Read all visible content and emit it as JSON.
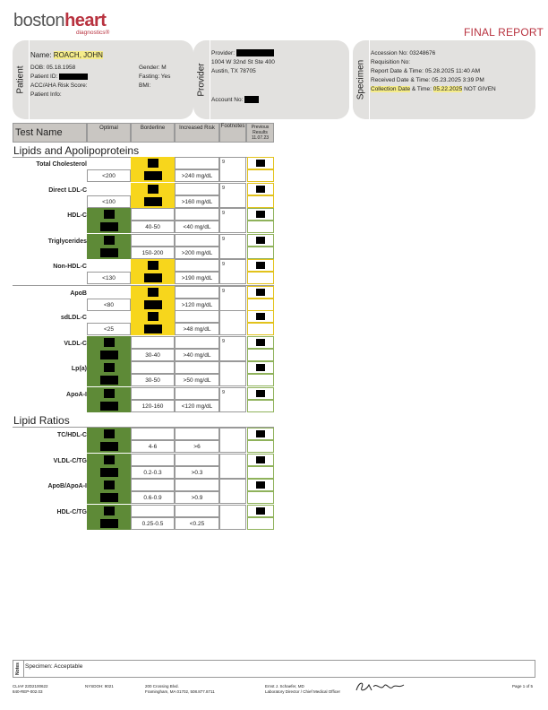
{
  "header": {
    "logo_main_a": "boston",
    "logo_main_b": "heart",
    "logo_sub": "diagnostics®",
    "report_title": "FINAL REPORT"
  },
  "patient": {
    "section_label": "Patient",
    "name_label": "Name:",
    "name_value": "ROACH, JOHN",
    "dob": "DOB: 05.18.1958",
    "patient_id_label": "Patient ID:",
    "risk_label": "ACC/AHA Risk Score:",
    "info_label": "Patient Info:",
    "gender": "Gender: M",
    "fasting": "Fasting: Yes",
    "bmi": "BMI:"
  },
  "provider": {
    "section_label": "Provider",
    "provider_label": "Provider:",
    "address1": "1004 W 32nd St Ste 400",
    "address2": "Austin, TX 78705",
    "account_label": "Account No:"
  },
  "specimen": {
    "section_label": "Specimen",
    "accession": "Accession No: 03248676",
    "requisition": "Requisition No:",
    "report_date": "Report Date & Time: 05.28.2025 11:40 AM",
    "received_date": "Received Date & Time: 05.23.2025 3:39 PM",
    "collection_label": "Collection Date",
    "collection_mid": " & Time: ",
    "collection_date": "05.22.2025",
    "collection_note": " NOT GIVEN"
  },
  "table_header": {
    "test_name": "Test Name",
    "optimal": "Optimal",
    "borderline": "Borderline",
    "increased": "Increased Risk",
    "footnotes": "Footnotes",
    "previous": "Previous Results",
    "previous_date": "11.07.23"
  },
  "sections": {
    "lipids": "Lipids and Apolipoproteins",
    "ratios": "Lipid Ratios"
  },
  "tests": [
    {
      "name": "Total Cholesterol",
      "optimal": "<200",
      "borderline": "",
      "increased": ">240 mg/dL",
      "footnote": "9",
      "zone": "borderline"
    },
    {
      "name": "Direct LDL-C",
      "optimal": "<100",
      "borderline": "",
      "increased": ">160 mg/dL",
      "footnote": "9",
      "zone": "borderline"
    },
    {
      "name": "HDL-C",
      "optimal": "",
      "borderline": "40-50",
      "increased": "<40 mg/dL",
      "footnote": "9",
      "zone": "optimal"
    },
    {
      "name": "Triglycerides",
      "optimal": "",
      "borderline": "150-200",
      "increased": ">200 mg/dL",
      "footnote": "9",
      "zone": "optimal"
    },
    {
      "name": "Non-HDL-C",
      "optimal": "<130",
      "borderline": "",
      "increased": ">190 mg/dL",
      "footnote": "9",
      "zone": "borderline"
    },
    {
      "name": "ApoB",
      "optimal": "<80",
      "borderline": "",
      "increased": ">120 mg/dL",
      "footnote": "9",
      "zone": "borderline"
    },
    {
      "name": "sdLDL-C",
      "optimal": "<25",
      "borderline": "",
      "increased": ">48 mg/dL",
      "footnote": "",
      "zone": "borderline"
    },
    {
      "name": "VLDL-C",
      "optimal": "",
      "borderline": "30-40",
      "increased": ">40 mg/dL",
      "footnote": "9",
      "zone": "optimal"
    },
    {
      "name": "Lp(a)",
      "optimal": "",
      "borderline": "30-50",
      "increased": ">50 mg/dL",
      "footnote": "",
      "zone": "optimal"
    },
    {
      "name": "ApoA-I",
      "optimal": "",
      "borderline": "120-160",
      "increased": "<120 mg/dL",
      "footnote": "9",
      "zone": "optimal"
    }
  ],
  "ratios": [
    {
      "name": "TC/HDL-C",
      "optimal": "",
      "borderline": "4-6",
      "increased": ">6",
      "footnote": "",
      "zone": "optimal"
    },
    {
      "name": "VLDL-C/TG",
      "optimal": "",
      "borderline": "0.2-0.3",
      "increased": ">0.3",
      "footnote": "",
      "zone": "optimal"
    },
    {
      "name": "ApoB/ApoA-I",
      "optimal": "",
      "borderline": "0.6-0.9",
      "increased": ">0.9",
      "footnote": "",
      "zone": "optimal"
    },
    {
      "name": "HDL-C/TG",
      "optimal": "",
      "borderline": "0.25-0.5",
      "increased": "<0.25",
      "footnote": "",
      "zone": "optimal"
    }
  ],
  "notes": {
    "label": "Notes",
    "text": "Specimen: Acceptable"
  },
  "footer": {
    "clia": "CLIA# 22D2100622",
    "nysdoh": "NYSDOH: 9021",
    "phone_code": "840-REP-002.03",
    "addr1": "200 Crossing Blvd.",
    "addr2": "Framingham,    MA 01702, 508.877.8711",
    "director": "Ernst J. Schaefer, MD",
    "director_title": "Laboratory Director / Chief Medical Officer",
    "page": "Page 1 of 5"
  },
  "colors": {
    "brand_red": "#b8323f",
    "optimal_green": "#5e8a37",
    "borderline_yellow": "#f7d61c",
    "card_gray": "#e2e1df"
  }
}
